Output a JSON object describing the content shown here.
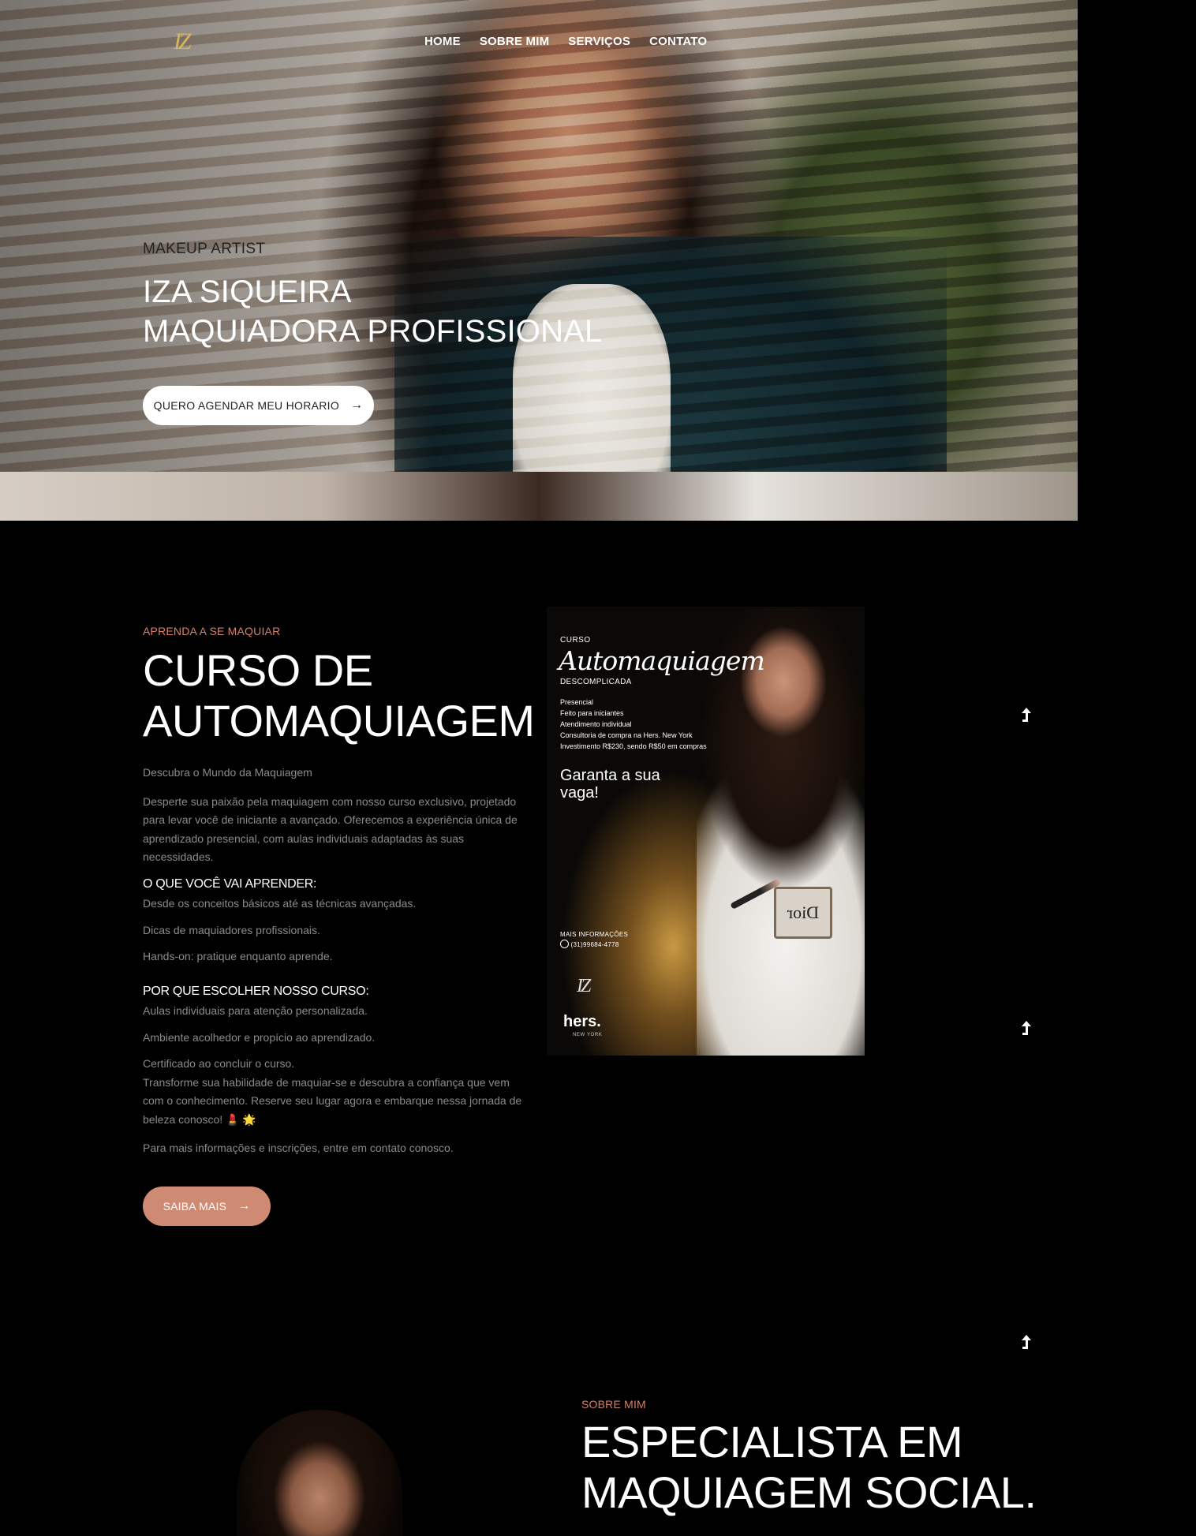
{
  "brand": {
    "logo_text": "IZ"
  },
  "nav": {
    "items": [
      {
        "label": "HOME"
      },
      {
        "label": "SOBRE MIM"
      },
      {
        "label": "SERVIÇOS"
      },
      {
        "label": "CONTATO"
      }
    ]
  },
  "hero": {
    "kicker": "MAKEUP ARTIST",
    "title_line1": "IZA SIQUEIRA",
    "title_line2": "MAQUIADORA PROFISSIONAL",
    "cta_label": "QUERO AGENDAR MEU HORARIO",
    "cta_arrow": "→"
  },
  "course": {
    "kicker": "APRENDA A SE MAQUIAR",
    "title_line1": "CURSO DE",
    "title_line2": "AUTOMAQUIAGEM",
    "intro_heading": "Descubra o Mundo da Maquiagem",
    "intro_text": "Desperte sua paixão pela maquiagem com nosso curso exclusivo, projetado para levar você de iniciante a avançado. Oferecemos a experiência única de aprendizado presencial, com aulas individuais adaptadas às suas necessidades.",
    "learn_heading": "O QUE VOCÊ VAI APRENDER:",
    "learn_items": [
      "Desde os conceitos básicos até as técnicas avançadas.",
      "Dicas de maquiadores profissionais.",
      "Hands-on: pratique enquanto aprende."
    ],
    "why_heading": "POR QUE ESCOLHER NOSSO CURSO:",
    "why_items": [
      "Aulas individuais para atenção personalizada.",
      "Ambiente acolhedor e propício ao aprendizado.",
      "Certificado ao concluir o curso."
    ],
    "closing_text": "Transforme sua habilidade de maquiar-se e descubra a confiança que vem com o conhecimento. Reserve seu lugar agora e embarque nessa jornada de beleza conosco! 💄 🌟",
    "contact_text": "Para mais informações e inscrições, entre em contato conosco.",
    "cta_label": "SAIBA MAIS",
    "cta_arrow": "→"
  },
  "poster": {
    "curso": "CURSO",
    "script_title": "Automaquiagem",
    "subtitle": "DESCOMPLICADA",
    "list": [
      "Presencial",
      "Feito para iniciantes",
      "Atendimento individual",
      "Consultoria de compra na Hers. New York",
      "Investimento R$230, sendo R$50 em compras"
    ],
    "garanta_line1": "Garanta a sua",
    "garanta_line2": "vaga!",
    "info_label": "MAIS INFORMAÇÕES",
    "phone": "(31)99684-4778",
    "compact_text": "Dior",
    "logo_text": "IZ",
    "brand": "hers.",
    "brand_sub": "NEW YORK"
  },
  "about": {
    "kicker": "SOBRE MIM",
    "title_line1": "ESPECIALISTA EM",
    "title_line2": "MAQUIAGEM SOCIAL."
  },
  "colors": {
    "accent": "#cf8a73",
    "logo_gold": "#d8b35c",
    "background": "#000000"
  }
}
